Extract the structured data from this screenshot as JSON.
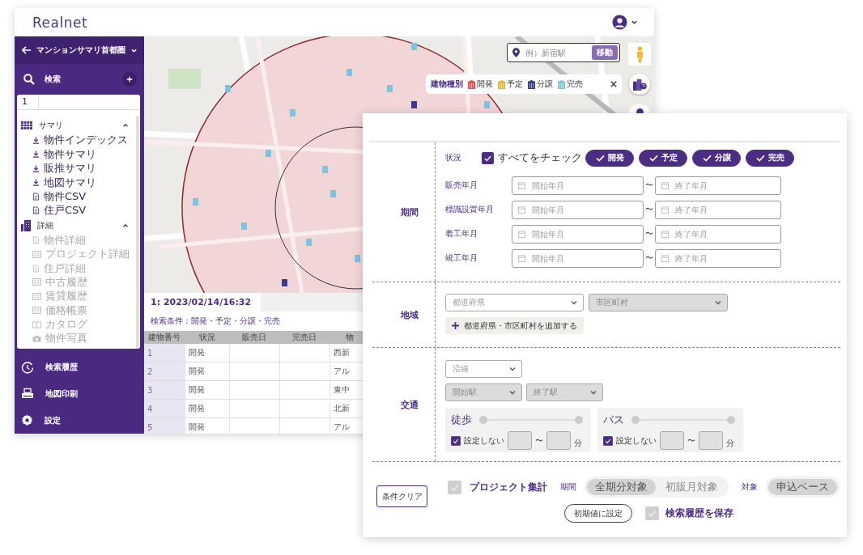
{
  "app": {
    "logo": "Realnet"
  },
  "sidebar": {
    "title": "マンションサマリ首都圏",
    "search_label": "検索",
    "panel_tab": "1",
    "groups": [
      {
        "label": "サマリ",
        "kind": "summary",
        "expanded": true,
        "items": [
          {
            "label": "物件インデックス",
            "kind": "download",
            "disabled": false
          },
          {
            "label": "物件サマリ",
            "kind": "download",
            "disabled": false
          },
          {
            "label": "販推サマリ",
            "kind": "download",
            "disabled": false
          },
          {
            "label": "地図サマリ",
            "kind": "download",
            "disabled": false
          },
          {
            "label": "物件CSV",
            "kind": "file",
            "disabled": false
          },
          {
            "label": "住戸CSV",
            "kind": "file",
            "disabled": false
          }
        ]
      },
      {
        "label": "詳細",
        "kind": "detail",
        "expanded": true,
        "items": [
          {
            "label": "物件詳細",
            "kind": "file",
            "disabled": true
          },
          {
            "label": "プロジェクト詳細",
            "kind": "table",
            "disabled": true
          },
          {
            "label": "住戸詳細",
            "kind": "file",
            "disabled": true
          },
          {
            "label": "中古履歴",
            "kind": "table",
            "disabled": true
          },
          {
            "label": "賃貸履歴",
            "kind": "table",
            "disabled": true
          },
          {
            "label": "価格帳票",
            "kind": "table",
            "disabled": true
          },
          {
            "label": "カタログ",
            "kind": "book",
            "disabled": true
          },
          {
            "label": "物件写真",
            "kind": "camera",
            "disabled": true
          }
        ]
      }
    ],
    "nav": [
      {
        "label": "検索履歴",
        "kind": "history"
      },
      {
        "label": "地図印刷",
        "kind": "print"
      },
      {
        "label": "設定",
        "kind": "settings"
      }
    ]
  },
  "map": {
    "kind": "picture",
    "search": {
      "placeholder": "例）新宿駅",
      "button": "移動"
    },
    "legend": {
      "title": "建物種別",
      "items": [
        {
          "label": "開発",
          "color": "#d9534f"
        },
        {
          "label": "予定",
          "color": "#e2b53c"
        },
        {
          "label": "分譲",
          "color": "#3b3a8c"
        },
        {
          "label": "完売",
          "color": "#7fc3dc"
        }
      ]
    }
  },
  "results": {
    "tab": "1: 2023/02/14/16:32",
    "conditions": "検索条件：開発・予定・分譲・完売",
    "columns": [
      "建物番号",
      "状況",
      "販売日",
      "完売日",
      "物"
    ],
    "rows": [
      {
        "number": "1",
        "status": "開発",
        "property": "西新"
      },
      {
        "number": "2",
        "status": "開発",
        "property": "アル"
      },
      {
        "number": "3",
        "status": "開発",
        "property": "東中"
      },
      {
        "number": "4",
        "status": "開発",
        "property": "北新"
      },
      {
        "number": "5",
        "status": "開発",
        "property": "アル"
      }
    ]
  },
  "search_form": {
    "period": {
      "label": "期間",
      "status": {
        "label": "状況",
        "check_all": {
          "label": "すべてをチェック",
          "checked": true
        },
        "chips": [
          {
            "label": "開発",
            "selected": true
          },
          {
            "label": "予定",
            "selected": true
          },
          {
            "label": "分譲",
            "selected": true
          },
          {
            "label": "完売",
            "selected": true
          }
        ]
      },
      "date_rows": [
        {
          "label": "販売年月",
          "from_placeholder": "開始年月",
          "separator": "〜",
          "to_placeholder": "終了年月"
        },
        {
          "label": "標識設置年月",
          "from_placeholder": "開始年月",
          "separator": "〜",
          "to_placeholder": "終了年月"
        },
        {
          "label": "着工年月",
          "from_placeholder": "開始年月",
          "separator": "〜",
          "to_placeholder": "終了年月"
        },
        {
          "label": "竣工年月",
          "from_placeholder": "開始年月",
          "separator": "〜",
          "to_placeholder": "終了年月"
        }
      ]
    },
    "area": {
      "label": "地域",
      "selects": [
        {
          "placeholder": "都道府県",
          "disabled": false
        },
        {
          "placeholder": "市区町村",
          "disabled": true
        }
      ],
      "add_button": "都道府県・市区町村を追加する"
    },
    "transport": {
      "label": "交通",
      "line_select": {
        "placeholder": "沿線",
        "disabled": false
      },
      "station_selects": [
        {
          "placeholder": "開始駅",
          "disabled": true
        },
        {
          "placeholder": "終了駅",
          "disabled": true
        }
      ],
      "modes": [
        {
          "label": "徒歩",
          "level": 1,
          "unset": {
            "label": "設定しない",
            "checked": true
          },
          "separator": "〜",
          "unit": "分"
        },
        {
          "label": "バス",
          "level": 1,
          "unset": {
            "label": "設定しない",
            "checked": true
          },
          "separator": "〜",
          "unit": "分"
        }
      ]
    },
    "footer": {
      "clear_button": "条件クリア",
      "project_total": {
        "label": "プロジェクト集計",
        "checked": true,
        "disabled": true
      },
      "period": {
        "label": "期間",
        "options": [
          {
            "label": "全期分対象",
            "selected": true
          },
          {
            "label": "初販月対象",
            "selected": false
          }
        ]
      },
      "target": {
        "label": "対象",
        "options": [
          {
            "label": "申込ベース",
            "selected": true
          }
        ]
      },
      "reset_button": "初期値に設定",
      "save_history": {
        "label": "検索履歴を保存",
        "checked": true,
        "disabled": true
      }
    }
  }
}
